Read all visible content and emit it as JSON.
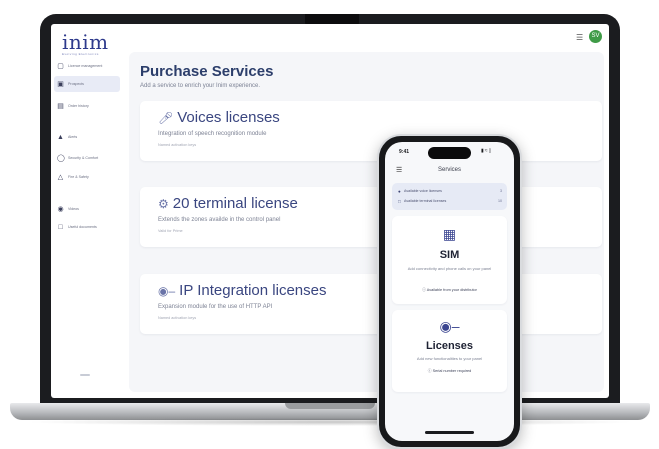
{
  "app": {
    "logo_text": "inim",
    "logo_subtitle": "Evolving Electronics",
    "avatar_initials": "SV",
    "accent_color": "#2c3e6b",
    "avatar_color": "#3f9b47"
  },
  "sidebar": {
    "items": [
      {
        "label": "Licence management",
        "icon": "license-icon",
        "active": false
      },
      {
        "label": "Prospects",
        "icon": "briefcase-icon",
        "active": true
      },
      {
        "label": "Order history",
        "icon": "history-icon",
        "active": false
      },
      {
        "label": "Alerts",
        "icon": "bell-icon",
        "active": false
      },
      {
        "label": "Security & Comfort",
        "icon": "shield-icon",
        "active": false
      },
      {
        "label": "Fire & Safety",
        "icon": "flame-icon",
        "active": false
      },
      {
        "label": "Videos",
        "icon": "video-icon",
        "active": false
      },
      {
        "label": "Useful documents",
        "icon": "document-icon",
        "active": false
      }
    ]
  },
  "main": {
    "title": "Purchase Services",
    "subtitle": "Add a service to enrich your Inim experience.",
    "cards": [
      {
        "title": "Voices licenses",
        "icon": "microphone-icon",
        "description": "Integration of speech recognition module",
        "note": "Named activation keys"
      },
      {
        "title": "20 terminal license",
        "icon": "puzzle-icon",
        "description": "Extends the zones availde in the control panel",
        "note": "Valid for Prime"
      },
      {
        "title": "IP Integration licenses",
        "icon": "key-icon",
        "description": "Expansion module for the use of HTTP API",
        "note": "Named activation keys"
      }
    ]
  },
  "phone": {
    "status_time": "9:41",
    "header_title": "Services",
    "available": [
      {
        "label": "Available voice licenses",
        "count": "3",
        "icon": "microphone-icon"
      },
      {
        "label": "Available terminal licenses",
        "count": "10",
        "icon": "terminal-icon"
      }
    ],
    "cards": [
      {
        "title": "SIM",
        "icon": "sim-card-icon",
        "description": "Add connectivity and phone calls on your panel",
        "note": "Available from your distributor",
        "note_icon": "info-icon"
      },
      {
        "title": "Licenses",
        "icon": "key-icon",
        "description": "Add new functionalities to your panel",
        "note": "Serial number required",
        "note_icon": "info-icon"
      }
    ]
  }
}
